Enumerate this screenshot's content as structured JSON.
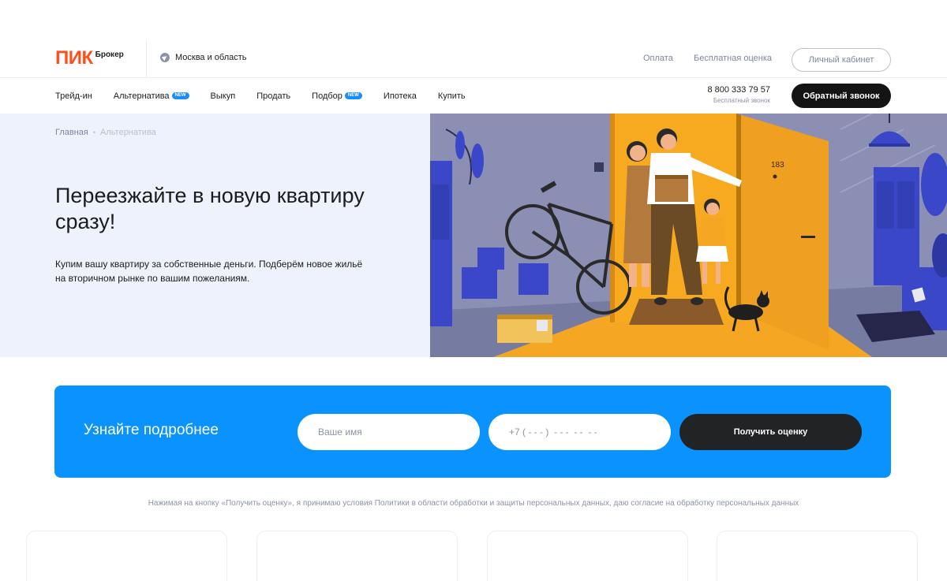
{
  "header": {
    "logo_mark": "ПИК",
    "logo_sub": "Брокер",
    "region": "Москва и область",
    "links": {
      "payment": "Оплата",
      "free_estimate": "Бесплатная оценка"
    },
    "cabinet_label": "Личный кабинет"
  },
  "nav": {
    "items": [
      {
        "label": "Трейд-ин"
      },
      {
        "label": "Альтернатива",
        "badge": "NEW"
      },
      {
        "label": "Выкуп"
      },
      {
        "label": "Продать"
      },
      {
        "label": "Подбор",
        "badge": "NEW"
      },
      {
        "label": "Ипотека"
      },
      {
        "label": "Купить"
      }
    ],
    "phone": "8 800 333 79 57",
    "phone_sub": "Бесплатный звонок",
    "callback_label": "Обратный звонок"
  },
  "hero": {
    "breadcrumb": {
      "home": "Главная",
      "sep": "•",
      "current": "Альтернатива"
    },
    "title": "Переезжайте в новую квартиру сразу!",
    "text": "Купим вашу квартиру за собственные деньги. Подберём новое жильё на вторичном рынке по вашим пожеланиям.",
    "door_number": "183"
  },
  "form": {
    "title": "Узнайте подробнее",
    "name_placeholder": "Ваше имя",
    "phone_placeholder": "+7 ( - - - )  - - -  - -  - -",
    "submit_label": "Получить оценку",
    "consent": "Нажимая на кнопку «Получить оценку», я принимаю условия Политики в области обработки и защиты персональных данных, даю согласие на обработку персональных данных"
  },
  "colors": {
    "brand_orange": "#ff4e1a",
    "accent_blue": "#0a93ff",
    "new_badge": "#1a8cff",
    "dark_button": "#141414",
    "hero_bg": "#eef2fc",
    "muted_text": "#7d86a3"
  }
}
